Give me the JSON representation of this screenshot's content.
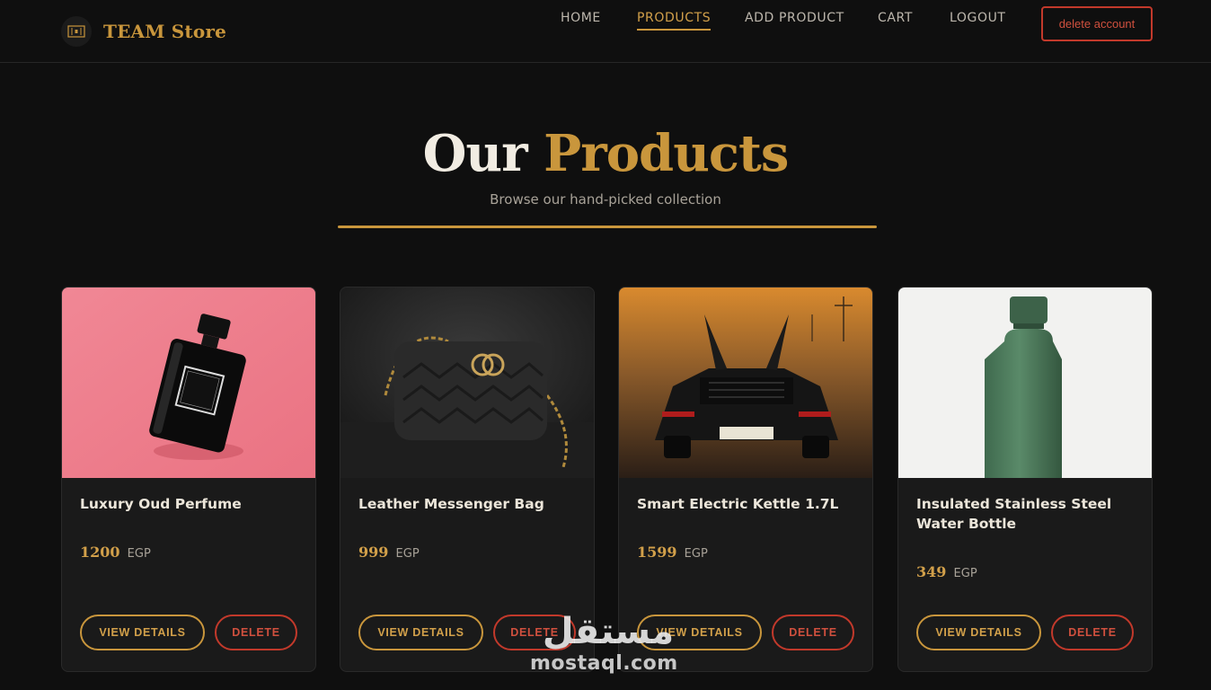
{
  "brand": {
    "name": "TEAM Store",
    "logo_icon": "storefront-icon"
  },
  "nav": {
    "items": [
      {
        "label": "HOME",
        "active": false
      },
      {
        "label": "PRODUCTS",
        "active": true
      },
      {
        "label": "ADD PRODUCT",
        "active": false
      },
      {
        "label": "CART",
        "active": false
      },
      {
        "label": "LOGOUT",
        "active": false
      }
    ],
    "delete_account_label": "delete account"
  },
  "hero": {
    "title_part1": "Our",
    "title_part2": "Products",
    "subtitle": "Browse our hand-picked collection"
  },
  "products": [
    {
      "name": "Luxury Oud Perfume",
      "price": "1200",
      "currency": "EGP",
      "image": "perfume-bottle-photo",
      "view_label": "VIEW DETAILS",
      "delete_label": "DELETE"
    },
    {
      "name": "Leather Messenger Bag",
      "price": "999",
      "currency": "EGP",
      "image": "leather-bag-photo",
      "view_label": "VIEW DETAILS",
      "delete_label": "DELETE"
    },
    {
      "name": "Smart Electric Kettle 1.7L",
      "price": "1599",
      "currency": "EGP",
      "image": "sports-car-photo",
      "view_label": "VIEW DETAILS",
      "delete_label": "DELETE"
    },
    {
      "name": "Insulated Stainless Steel Water Bottle",
      "price": "349",
      "currency": "EGP",
      "image": "water-bottle-photo",
      "view_label": "VIEW DETAILS",
      "delete_label": "DELETE"
    }
  ],
  "watermark": {
    "text": "mostaql.com",
    "arabic": "مستقل"
  },
  "colors": {
    "accent": "#c9963c",
    "danger": "#c2392b",
    "background": "#0f0f0f",
    "card": "#1a1a1a"
  }
}
